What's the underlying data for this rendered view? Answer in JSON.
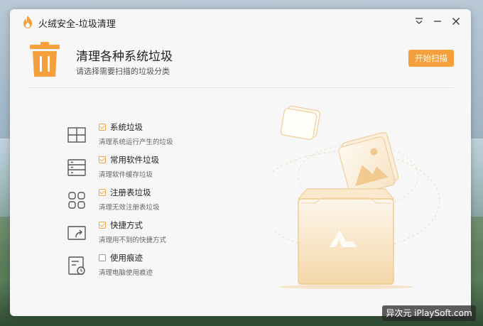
{
  "window": {
    "title": "火绒安全-垃圾清理"
  },
  "header": {
    "title": "清理各种系统垃圾",
    "subtitle": "请选择需要扫描的垃圾分类",
    "scan_button": "开始扫描"
  },
  "categories": [
    {
      "icon": "windows-icon",
      "checked": true,
      "title": "系统垃圾",
      "desc": "清理系统运行产生的垃圾"
    },
    {
      "icon": "software-icon",
      "checked": true,
      "title": "常用软件垃圾",
      "desc": "清理软件缓存垃圾"
    },
    {
      "icon": "registry-icon",
      "checked": true,
      "title": "注册表垃圾",
      "desc": "清理无效注册表垃圾"
    },
    {
      "icon": "shortcut-icon",
      "checked": true,
      "title": "快捷方式",
      "desc": "清理用不到的快捷方式"
    },
    {
      "icon": "history-icon",
      "checked": false,
      "title": "使用痕迹",
      "desc": "清理电脑使用痕迹"
    }
  ],
  "colors": {
    "accent": "#f5a03d"
  },
  "watermark": "异次元 iPlaySoft.com"
}
